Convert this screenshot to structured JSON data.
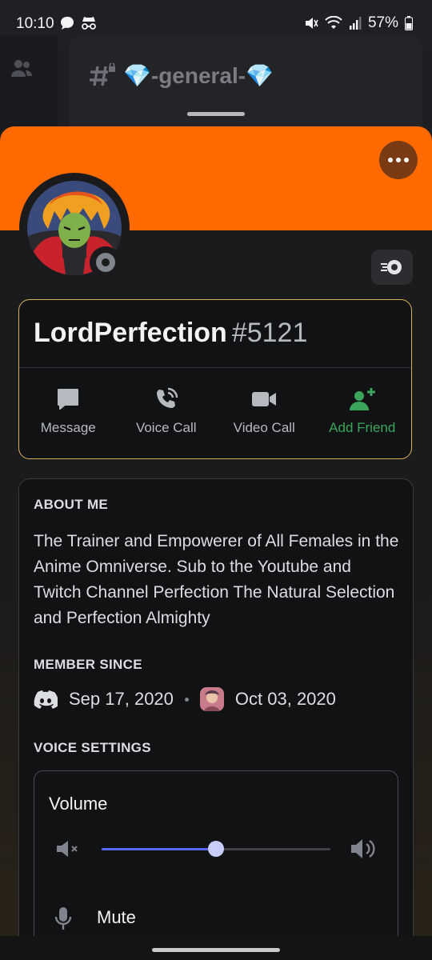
{
  "status_bar": {
    "time": "10:10",
    "battery": "57%"
  },
  "background": {
    "channel_name": "💎-general-💎"
  },
  "profile": {
    "username": "LordPerfection",
    "discriminator": "#5121",
    "banner_color": "#ff6a00",
    "accent_border_color": "#d8b35a",
    "status": "offline"
  },
  "actions": [
    {
      "label": "Message",
      "icon": "message-icon"
    },
    {
      "label": "Voice Call",
      "icon": "phone-icon"
    },
    {
      "label": "Video Call",
      "icon": "video-camera-icon"
    },
    {
      "label": "Add Friend",
      "icon": "add-friend-icon"
    }
  ],
  "about": {
    "heading": "ABOUT ME",
    "text": "The Trainer and Empowerer of All Females in the Anime Omniverse. Sub to the Youtube and Twitch Channel Perfection The Natural Selection  and Perfection Almighty"
  },
  "member_since": {
    "heading": "MEMBER SINCE",
    "discord_date": "Sep 17, 2020",
    "server_date": "Oct 03, 2020"
  },
  "voice_settings": {
    "heading": "VOICE SETTINGS",
    "volume_label": "Volume",
    "volume_level": 0.5,
    "mute_label": "Mute"
  }
}
